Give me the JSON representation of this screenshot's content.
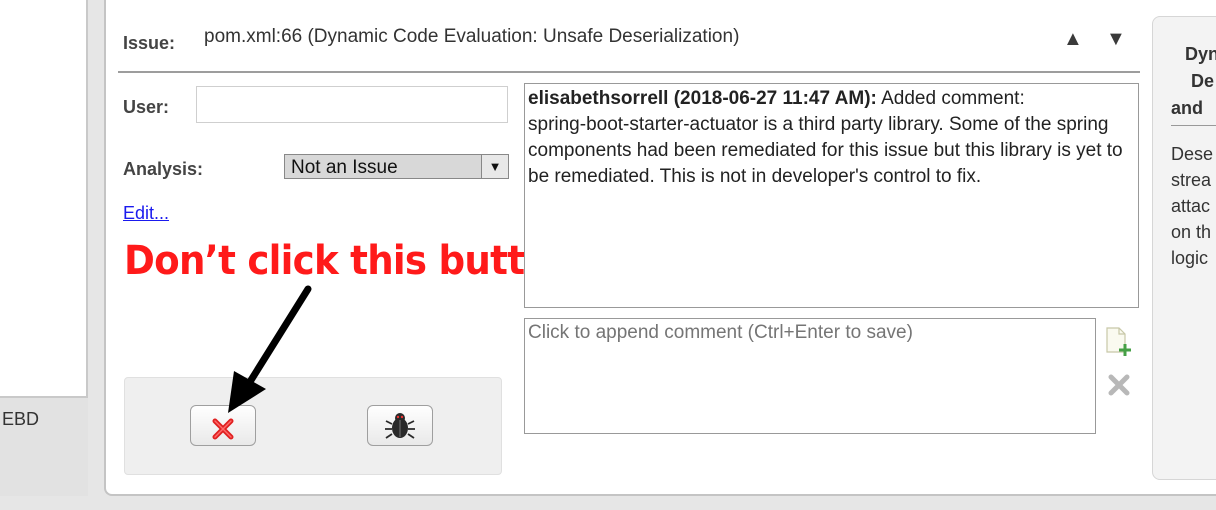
{
  "left_panel": {
    "label": "EBD"
  },
  "issue": {
    "label": "Issue:",
    "value": "pom.xml:66 (Dynamic Code Evaluation: Unsafe Deserialization)"
  },
  "form": {
    "user_label": "User:",
    "user_value": "",
    "analysis_label": "Analysis:",
    "analysis_value": "Not an Issue",
    "edit_link": "Edit..."
  },
  "annotation": {
    "warning": "Don’t click this button!!",
    "color": "#ff1a1a"
  },
  "buttons": {
    "delete_icon": "red-x-icon",
    "bug_icon": "bug-icon"
  },
  "comment_history": {
    "author": "elisabethsorrell (2018-06-27 11:47 AM):",
    "action": "Added comment:",
    "text": "spring-boot-starter-actuator is a third party library. Some of the spring components had been remediated for this issue but this library is yet to be remediated. This is not in developer's control to fix."
  },
  "comment_input": {
    "placeholder": "Click to append comment (Ctrl+Enter to save)"
  },
  "right_panel": {
    "title_lines": [
      "Dyn",
      "De",
      "and"
    ],
    "body_lines": [
      "Dese",
      "strea",
      "attac",
      "on th",
      "logic"
    ]
  },
  "colors": {
    "accent_red": "#ff1a1a",
    "link_blue": "#1a1aee"
  }
}
